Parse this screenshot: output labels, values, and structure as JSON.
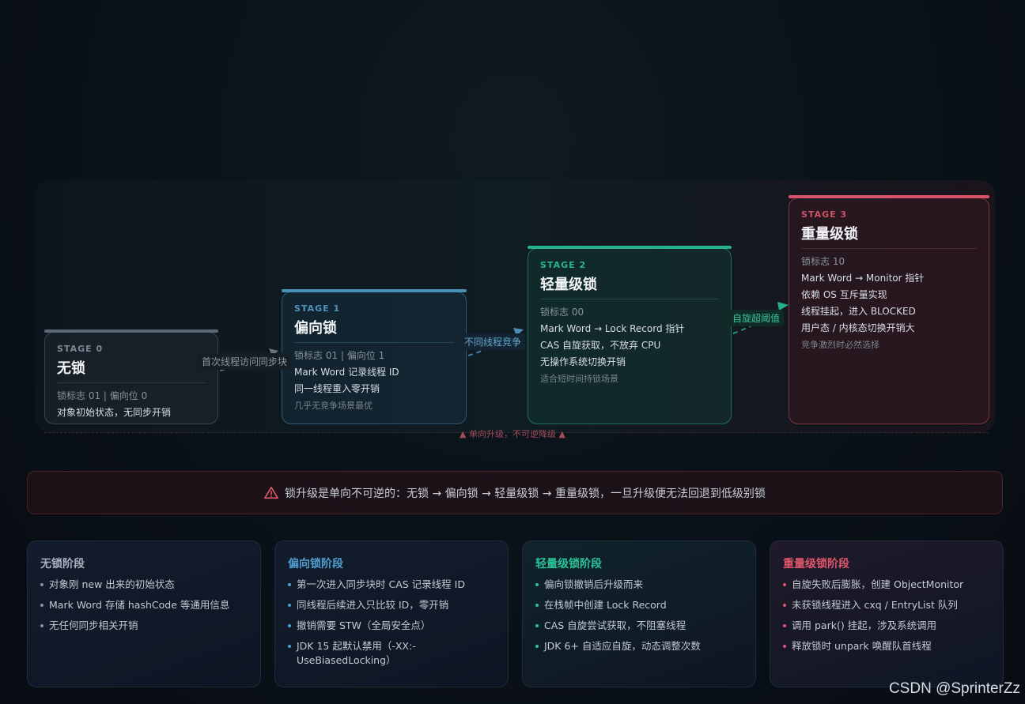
{
  "stages": [
    {
      "tag": "STAGE 0",
      "title": "无锁",
      "bits": "锁标志 01 | 偏向位 0",
      "lines": [
        "对象初始状态，无同步开销"
      ],
      "note": ""
    },
    {
      "tag": "STAGE 1",
      "title": "偏向锁",
      "bits": "锁标志 01 | 偏向位 1",
      "lines": [
        "Mark Word 记录线程 ID",
        "同一线程重入零开销"
      ],
      "note": "几乎无竞争场景最优"
    },
    {
      "tag": "STAGE 2",
      "title": "轻量级锁",
      "bits": "锁标志 00",
      "lines": [
        "Mark Word → Lock Record 指针",
        "CAS 自旋获取，不放弃 CPU",
        "无操作系统切换开销"
      ],
      "note": "适合短时间持锁场景"
    },
    {
      "tag": "STAGE 3",
      "title": "重量级锁",
      "bits": "锁标志 10",
      "lines": [
        "Mark Word → Monitor 指针",
        "依赖 OS 互斥量实现",
        "线程挂起，进入 BLOCKED",
        "用户态 / 内核态切换开销大"
      ],
      "note": "竞争激烈时必然选择"
    }
  ],
  "transitions": [
    "首次线程访问同步块",
    "不同线程竞争",
    "自旋超阈值"
  ],
  "upgrade_note": "▲ 单向升级，不可逆降级 ▲",
  "warning": "锁升级是单向不可逆的：无锁 → 偏向锁 → 轻量级锁 → 重量级锁，一旦升级便无法回退到低级别锁",
  "cards": [
    {
      "title": "无锁阶段",
      "items": [
        "对象刚 new 出来的初始状态",
        "Mark Word 存储 hashCode 等通用信息",
        "无任何同步相关开销"
      ]
    },
    {
      "title": "偏向锁阶段",
      "items": [
        "第一次进入同步块时 CAS 记录线程 ID",
        "同线程后续进入只比较 ID，零开销",
        "撤销需要 STW（全局安全点）",
        "JDK 15 起默认禁用（-XX:-UseBiasedLocking）"
      ]
    },
    {
      "title": "轻量级锁阶段",
      "items": [
        "偏向锁撤销后升级而来",
        "在栈帧中创建 Lock Record",
        "CAS 自旋尝试获取，不阻塞线程",
        "JDK 6+ 自适应自旋，动态调整次数"
      ]
    },
    {
      "title": "重量级锁阶段",
      "items": [
        "自旋失败后膨胀，创建 ObjectMonitor",
        "未获锁线程进入 cxq / EntryList 队列",
        "调用 park() 挂起，涉及系统调用",
        "释放锁时 unpark 唤醒队首线程"
      ]
    }
  ],
  "watermark": "CSDN @SprinterZz",
  "colors": {
    "stage0": "#5b6878",
    "stage1": "#4a8fb5",
    "stage2": "#23b08c",
    "stage3": "#d7546a"
  }
}
